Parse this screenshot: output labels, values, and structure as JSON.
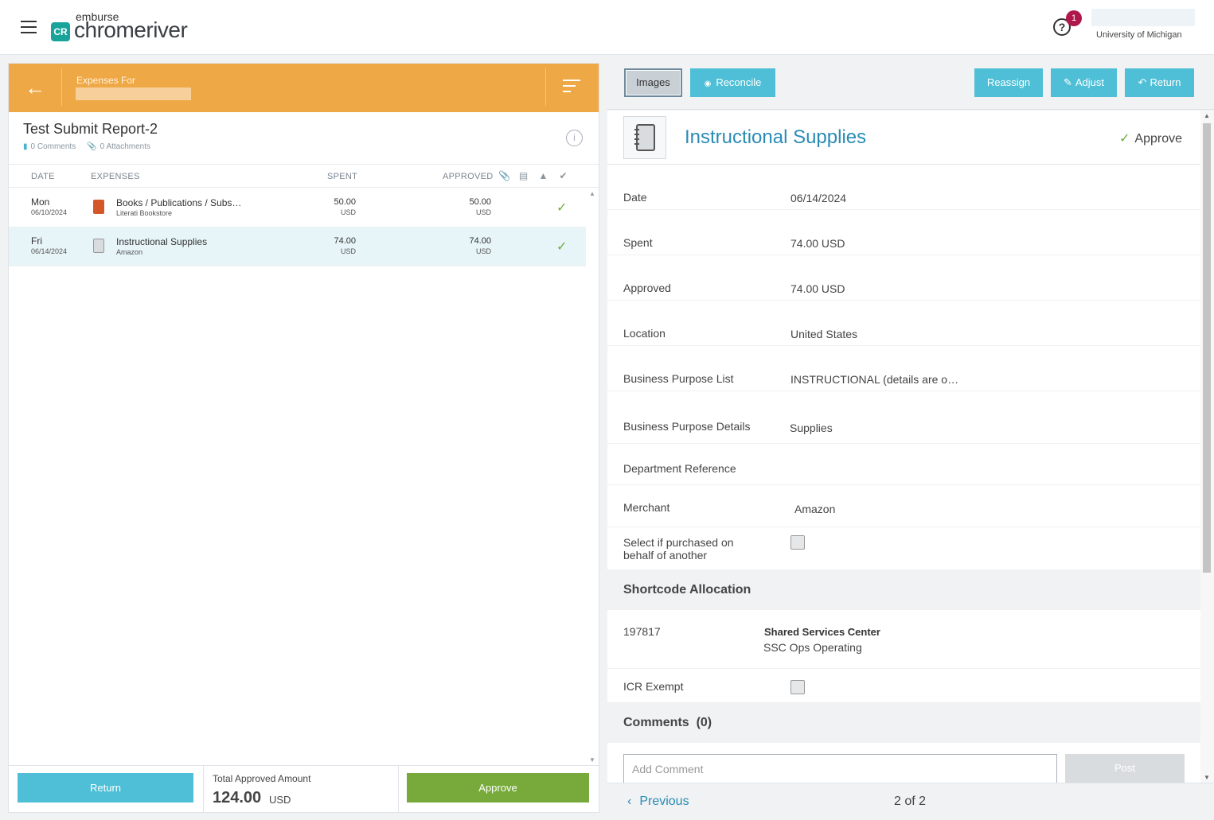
{
  "header": {
    "brand_small": "emburse",
    "brand_main": "chromeriver",
    "brand_mark": "CR",
    "help_icon_glyph": "?",
    "notification_count": "1",
    "organization": "University of Michigan"
  },
  "report": {
    "expenses_for_label": "Expenses For",
    "title": "Test Submit Report-2",
    "comments": "0 Comments",
    "attachments": "0 Attachments"
  },
  "table": {
    "columns": {
      "date": "DATE",
      "expenses": "EXPENSES",
      "spent": "SPENT",
      "approved": "APPROVED"
    },
    "rows": [
      {
        "day": "Mon",
        "date": "06/10/2024",
        "name": "Books / Publications / Subs…",
        "merchant": "Literati Bookstore",
        "spent": "50.00",
        "spent_currency": "USD",
        "approved": "50.00",
        "approved_currency": "USD",
        "icon": "book-icon",
        "icon_color": "#d4572a"
      },
      {
        "day": "Fri",
        "date": "06/14/2024",
        "name": "Instructional Supplies",
        "merchant": "Amazon",
        "spent": "74.00",
        "spent_currency": "USD",
        "approved": "74.00",
        "approved_currency": "USD",
        "icon": "notebook-icon",
        "icon_color": "#d9dcdf"
      }
    ]
  },
  "footer": {
    "return_label": "Return",
    "total_label": "Total Approved Amount",
    "total_amount": "124.00",
    "total_currency": "USD",
    "approve_label": "Approve"
  },
  "toolbar": {
    "images_label": "Images",
    "reconcile_label": "Reconcile",
    "reassign_label": "Reassign",
    "adjust_label": "Adjust",
    "return_label": "Return"
  },
  "detail": {
    "title": "Instructional Supplies",
    "approve_label": "Approve",
    "fields": {
      "date_label": "Date",
      "date_value": "06/14/2024",
      "spent_label": "Spent",
      "spent_value": "74.00 USD",
      "approved_label": "Approved",
      "approved_value": "74.00 USD",
      "location_label": "Location",
      "location_value": "United States",
      "bp_list_label": "Business Purpose List",
      "bp_list_value": "INSTRUCTIONAL (details are o…",
      "bp_details_label": "Business Purpose Details",
      "bp_details_value": "Supplies",
      "dept_ref_label": "Department Reference",
      "merchant_label": "Merchant",
      "merchant_value": "Amazon",
      "behalf_label_1": "Select if purchased on",
      "behalf_label_2": "behalf of another"
    },
    "shortcode": {
      "section_title": "Shortcode Allocation",
      "code": "197817",
      "org_title": "Shared Services Center",
      "org_sub": "SSC Ops Operating",
      "icr_label": "ICR Exempt"
    },
    "comments": {
      "section_title": "Comments  (0)",
      "placeholder": "Add Comment",
      "post_label": "Post"
    }
  },
  "pager": {
    "previous_label": "Previous",
    "count": "2 of 2"
  },
  "colors": {
    "orange": "#efa846",
    "teal": "#4ebfd6",
    "green": "#77aa3a",
    "link_blue": "#2a8bb5",
    "badge": "#b0184b"
  }
}
